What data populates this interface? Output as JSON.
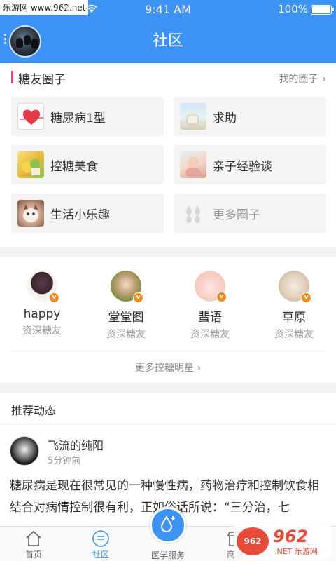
{
  "status_bar": {
    "watermark": "乐游网 www.962.net",
    "carrier": "动",
    "time": "9:41 AM",
    "battery_text": "100%"
  },
  "header": {
    "title": "社区"
  },
  "circles": {
    "title": "糖友圈子",
    "my_circles_link": "我的圈子",
    "items": [
      {
        "label": "糖尿病1型",
        "icon": "heart-icon"
      },
      {
        "label": "求助",
        "icon": "beach-photo-icon"
      },
      {
        "label": "控糖美食",
        "icon": "food-photo-icon"
      },
      {
        "label": "亲子经验谈",
        "icon": "baby-photo-icon"
      },
      {
        "label": "生活小乐趣",
        "icon": "cat-photo-icon"
      },
      {
        "label": "更多圈子",
        "icon": "drops-icon"
      }
    ]
  },
  "stars": {
    "items": [
      {
        "name": "happy",
        "tag": "资深糖友"
      },
      {
        "name": "堂堂图",
        "tag": "资深糖友"
      },
      {
        "name": "蜚语",
        "tag": "资深糖友"
      },
      {
        "name": "草原",
        "tag": "资深糖友"
      }
    ],
    "badge": "v",
    "more_link": "更多控糖明星"
  },
  "feed": {
    "title": "推荐动态",
    "post": {
      "author": "飞流的纯阳",
      "time": "5分钟前",
      "body": "糖尿病是现在很常见的一种慢性病，药物治疗和控制饮食相结合对病情控制很有利，正如俗话所说：“三分治，七"
    }
  },
  "bottom_nav": {
    "items": [
      {
        "label": "首页",
        "icon": "home-icon"
      },
      {
        "label": "社区",
        "icon": "community-icon"
      },
      {
        "label": "医学服务",
        "icon": "drop-plus-icon"
      },
      {
        "label": "商城",
        "icon": "shop-icon"
      },
      {
        "label": "",
        "icon": "profile-icon"
      }
    ]
  },
  "watermark": {
    "logo": "962",
    "brand": "962",
    "site": ".NET 乐游网"
  },
  "colors": {
    "primary": "#3d93f3",
    "accent": "#e7487a",
    "badge": "#f08a1e"
  }
}
